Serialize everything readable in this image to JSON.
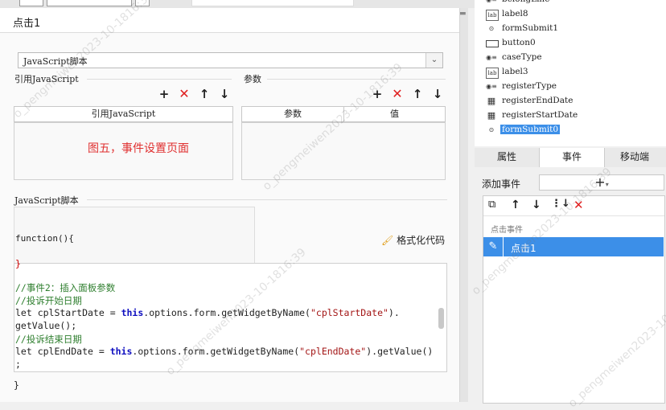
{
  "dialog": {
    "title": "点击1",
    "script_select": "JavaScript脚本",
    "ref_section_label": "引用JavaScript",
    "param_section_label": "参数",
    "ref_table_header": "引用JavaScript",
    "param_table_headers": [
      "参数",
      "值"
    ],
    "annotation": "图五，事件设置页面",
    "script_section_label": "JavaScript脚本",
    "function_signature": "function(){",
    "format_code_label": "格式化代码",
    "code_lines": [
      {
        "text": "}",
        "cls": ""
      },
      {
        "text": "",
        "cls": ""
      },
      {
        "text": "//事件2：插入面板参数",
        "cls": "cm"
      },
      {
        "text": "//投诉开始日期",
        "cls": "cm"
      },
      {
        "text": "let cplStartDate = this.options.form.getWidgetByName(\"cplStartDate\").",
        "cls": ""
      },
      {
        "text": "getValue();",
        "cls": ""
      },
      {
        "text": "//投诉结束日期",
        "cls": "cm"
      },
      {
        "text": "let cplEndDate = this.options.form.getWidgetByName(\"cplEndDate\").getValue()",
        "cls": ""
      },
      {
        "text": ";",
        "cls": ""
      },
      {
        "text": "}",
        "cls": ""
      }
    ]
  },
  "tree": {
    "items": [
      {
        "label": "belongLine",
        "icon": "radio-group-icon"
      },
      {
        "label": "label8",
        "icon": "label-icon"
      },
      {
        "label": "formSubmit1",
        "icon": "form-submit-icon"
      },
      {
        "label": "button0",
        "icon": "button-icon"
      },
      {
        "label": "caseType",
        "icon": "radio-group-icon"
      },
      {
        "label": "label3",
        "icon": "label-icon"
      },
      {
        "label": "registerType",
        "icon": "radio-group-icon"
      },
      {
        "label": "registerEndDate",
        "icon": "date-icon"
      },
      {
        "label": "registerStartDate",
        "icon": "date-icon"
      },
      {
        "label": "formSubmit0",
        "icon": "form-submit-icon"
      }
    ],
    "selected_index": 9
  },
  "tabs": [
    "属性",
    "事件",
    "移动端"
  ],
  "events": {
    "add_label": "添加事件",
    "add_button": "+",
    "group_label": "点击事件",
    "item_label": "点击1"
  },
  "watermark": "o_pengmeiwen2023-10-1816:39",
  "colors": {
    "accent": "#3c8fe8",
    "annotation": "#e03030",
    "delete": "#e02020"
  }
}
